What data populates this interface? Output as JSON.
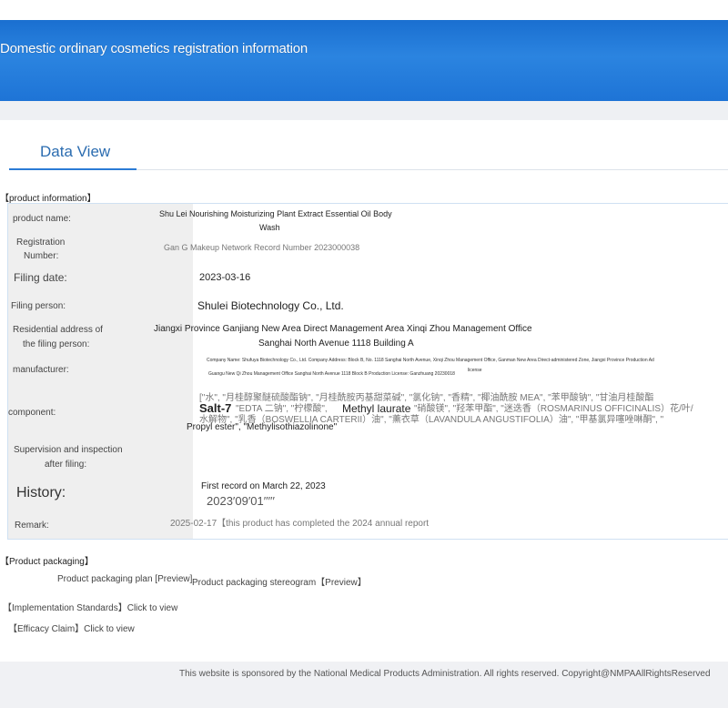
{
  "header": {
    "title": "Domestic ordinary cosmetics registration information"
  },
  "tabs": [
    {
      "label": "Data View"
    }
  ],
  "product_info": {
    "heading": "【product information】",
    "rows": {
      "product_name": {
        "label": "product name:",
        "value_line1": "Shu Lei Nourishing Moisturizing Plant Extract Essential Oil Body",
        "value_line2": "Wash"
      },
      "registration_number": {
        "label_line1": "Registration",
        "label_line2": "Number:",
        "value": "Gan G Makeup Network Record Number 2023000038"
      },
      "filing_date": {
        "label": "Filing date:",
        "value": "2023-03-16"
      },
      "filing_person": {
        "label": "Filing person:",
        "value": "Shulei Biotechnology Co., Ltd."
      },
      "residential_address": {
        "label_line1": "Residential address of",
        "label_line2": "the filing person:",
        "value_line1": "Jiangxi Province Ganjiang New Area Direct Management Area Xinqi Zhou Management Office",
        "value_line2": "Sanghai North Avenue 1118 Building A"
      },
      "manufacturer": {
        "label": "manufacturer:",
        "value_line1": "Company Name: Shufuya Biotechnology Co., Ltd. Company Address: Block B, No. 1118 Sanghai North Avenue, Xinqi Zhou Management Office, Ganman New Area Direct-administered Zone, Jiangxi Province Production Ad",
        "value_line2": "Guangu New Qi Zhou Management Office Sanghai North Avenue 1118 Block B Production License: Ganzhuang 20230018",
        "value_small": "license"
      },
      "component": {
        "label": "component:",
        "line1": "[\"水\", \"月桂醇聚醚硫酸酯钠\", \"月桂酰胺丙基甜菜碱\", \"氯化钠\", \"香精\", \"椰油酰胺 MEA\", \"苯甲酸钠\", \"甘油月桂酸酯",
        "salt_label": "Salt-7",
        "line2_a": "\"EDTA 二钠\", \"柠檬酸\",",
        "methyl_label": "Methyl laurate",
        "line2_b": "\"硝酸镁\", \"羟苯甲酯\", \"迷迭香（ROSMARINUS OFFICINALIS）花/叶/",
        "line3": "水解物\", \"乳香（BOSWELLIA CARTERII）油\", \"薰衣草（LAVANDULA ANGUSTIFOLIA）油\", \"甲基氯异噻唑啉酮\", \"",
        "line4": "Propyl ester\", \"Methylisothiazolinone\""
      },
      "supervision": {
        "label_line1": "Supervision and inspection",
        "label_line2": "after filing:",
        "value": ""
      },
      "history": {
        "label": "History:",
        "value_line1": "First record on March 22, 2023",
        "value_line2": "2023′09′01′′′′′"
      },
      "remark": {
        "label": "Remark:",
        "value": "2025-02-17【this product has completed the 2024 annual report"
      }
    }
  },
  "packaging": {
    "heading": "【Product packaging】",
    "plan_link": "Product packaging plan [Preview]",
    "stereogram_link": "Product packaging stereogram【Preview】"
  },
  "standards": {
    "label": "【Implementation Standards】Click to view"
  },
  "efficacy": {
    "label": "【Efficacy Claim】Click to view"
  },
  "footer": {
    "text": "This website is sponsored by the National Medical Products Administration. All rights reserved. Copyright@NMPAAllRightsReserved"
  },
  "colors": {
    "banner": "#1a6fd0",
    "tab_accent": "#2b7bd6",
    "table_border": "#cfe0f2"
  }
}
